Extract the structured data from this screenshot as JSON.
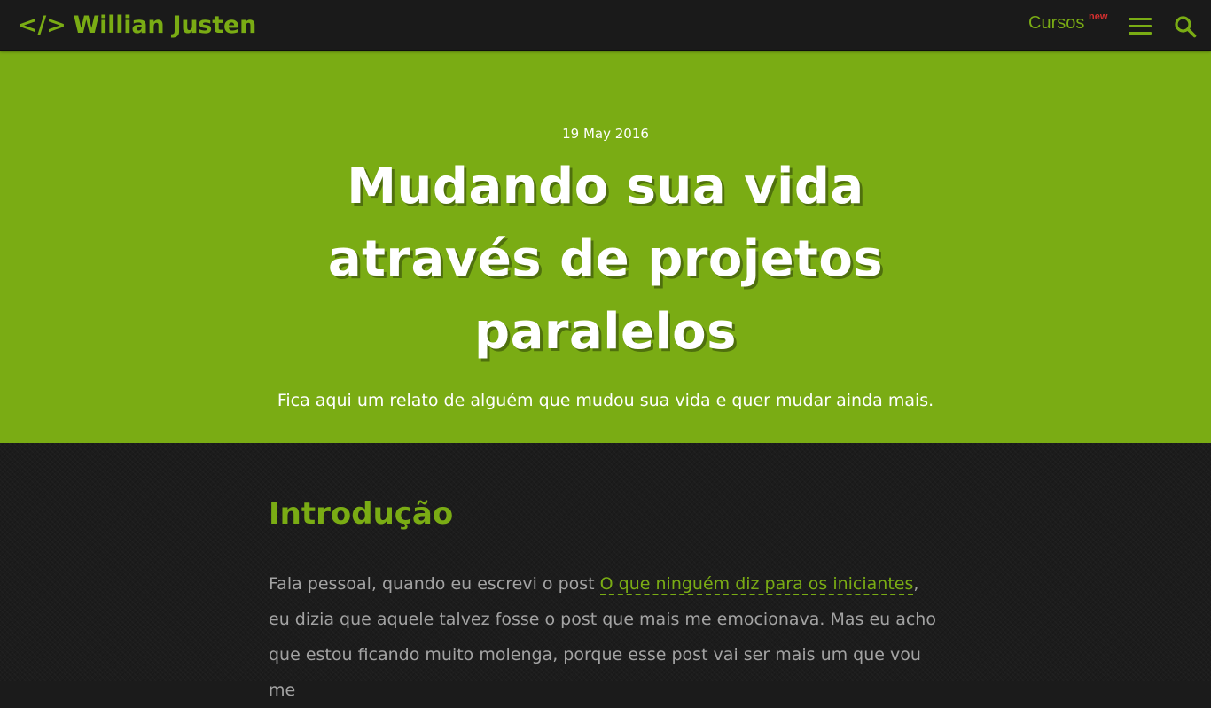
{
  "header": {
    "brand_icon": "</>",
    "brand_name": "Willian Justen",
    "nav_cursos": "Cursos",
    "nav_cursos_badge": "new",
    "menu_icon": "hamburger-menu-icon",
    "search_icon": "search-icon",
    "accent_color": "#7aac14"
  },
  "hero": {
    "date": "19 May 2016",
    "title": "Mudando sua vida através de projetos paralelos",
    "subtitle": "Fica aqui um relato de alguém que mudou sua vida e quer mudar ainda mais.",
    "background_color": "#7aac14"
  },
  "article": {
    "section_title": "Introdução",
    "paragraph_before_link": "Fala pessoal, quando eu escrevi o post ",
    "paragraph_link": "O que ninguém diz para os iniciantes",
    "paragraph_after_link": ", eu dizia que aquele talvez fosse o post que mais me emocionava. Mas eu acho que estou ficando muito molenga, porque esse post vai ser mais um que vou me"
  }
}
